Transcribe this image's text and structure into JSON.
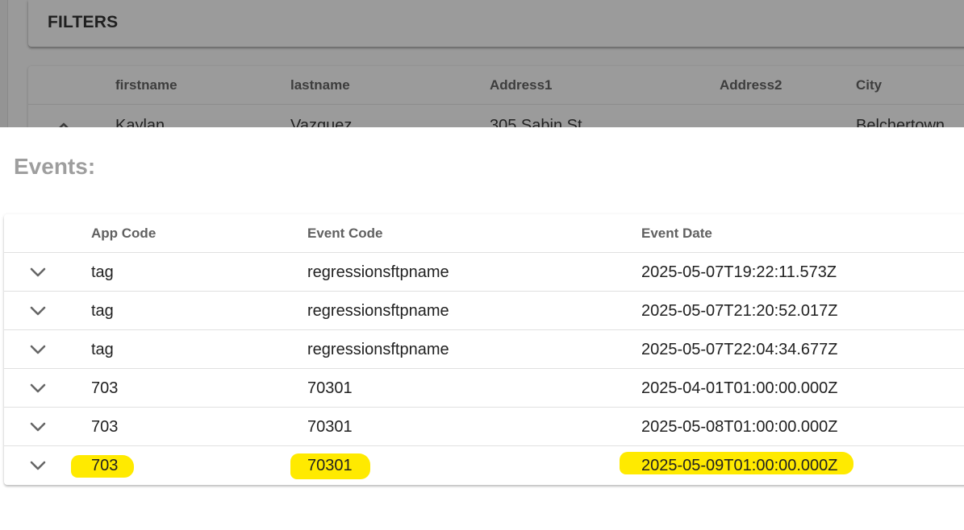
{
  "filters": {
    "title": "FILTERS"
  },
  "people_table": {
    "columns": [
      "firstname",
      "lastname",
      "Address1",
      "Address2",
      "City"
    ],
    "row": {
      "firstname": "Kaylan",
      "lastname": "Vazquez",
      "address1": "305 Sabin St",
      "address2": "",
      "city": "Belchertown"
    }
  },
  "events": {
    "title": "Events:",
    "columns": [
      "App Code",
      "Event Code",
      "Event Date"
    ],
    "rows": [
      {
        "app_code": "tag",
        "event_code": "regressionsftpname",
        "event_date": "2025-05-07T19:22:11.573Z",
        "highlighted": false
      },
      {
        "app_code": "tag",
        "event_code": "regressionsftpname",
        "event_date": "2025-05-07T21:20:52.017Z",
        "highlighted": false
      },
      {
        "app_code": "tag",
        "event_code": "regressionsftpname",
        "event_date": "2025-05-07T22:04:34.677Z",
        "highlighted": false
      },
      {
        "app_code": "703",
        "event_code": "70301",
        "event_date": "2025-04-01T01:00:00.000Z",
        "highlighted": false
      },
      {
        "app_code": "703",
        "event_code": "70301",
        "event_date": "2025-05-08T01:00:00.000Z",
        "highlighted": false
      },
      {
        "app_code": "703",
        "event_code": "70301",
        "event_date": "2025-05-09T01:00:00.000Z",
        "highlighted": true
      }
    ]
  },
  "icons": {
    "expand": "chevron-down-icon",
    "collapse": "chevron-up-icon"
  },
  "colors": {
    "highlight": "#ffea00",
    "overlay": "#9a9a9a",
    "events_title": "#9e9e9e"
  }
}
